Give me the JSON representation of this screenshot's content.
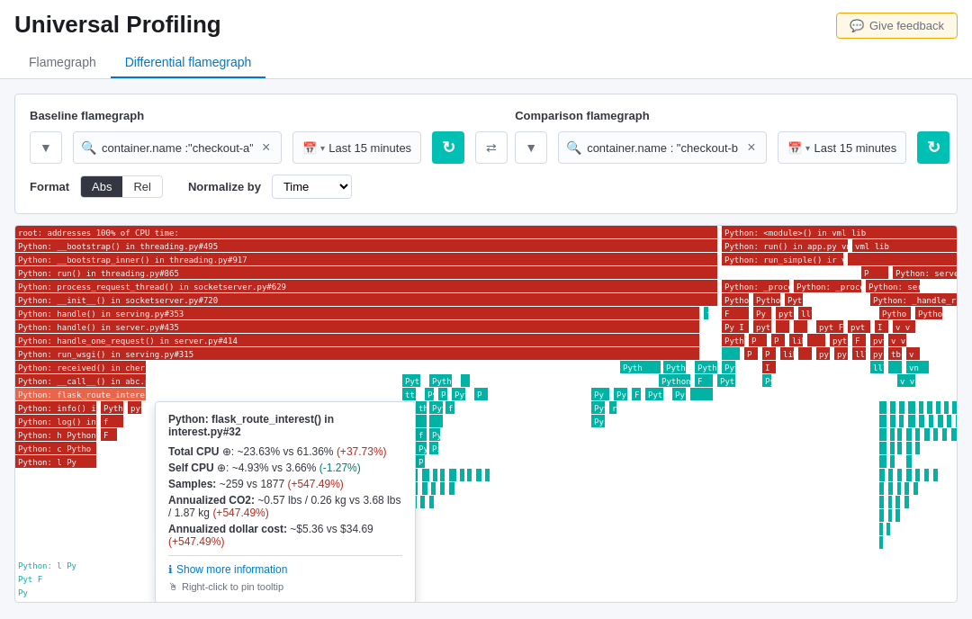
{
  "header": {
    "title": "Universal Profiling",
    "feedback_button": "Give feedback"
  },
  "tabs": [
    {
      "id": "flamegraph",
      "label": "Flamegraph",
      "active": false
    },
    {
      "id": "differential",
      "label": "Differential flamegraph",
      "active": true
    }
  ],
  "baseline": {
    "label": "Baseline flamegraph",
    "filter_placeholder": "container.name :\"checkout-a\"",
    "date_label": "Last 15 minutes"
  },
  "comparison": {
    "label": "Comparison flamegraph",
    "filter_placeholder": "container.name : \"checkout-b\"",
    "date_label": "Last 15 minutes"
  },
  "format": {
    "label": "Format",
    "options": [
      "Abs",
      "Rel"
    ],
    "active": "Abs"
  },
  "normalize": {
    "label": "Normalize by",
    "value": "Time"
  },
  "tooltip": {
    "title": "Python: flask_route_interest() in interest.py#32",
    "total_cpu_label": "Total CPU",
    "total_cpu_value": "~: ~23.63% vs 61.36% (+37.73%)",
    "self_cpu_label": "Self CPU",
    "self_cpu_value": "~: ~4.93% vs 3.66% (-1.27%)",
    "samples_label": "Samples",
    "samples_value": "~259 vs 1877 (+547.49%)",
    "co2_label": "Annualized CO2:",
    "co2_value": "~0.57 lbs / 0.26 kg vs 3.68 lbs / 1.87 kg (+547.49%)",
    "dollar_label": "Annualized dollar cost:",
    "dollar_value": "~$5.36 vs $34.69 (+547.49%)",
    "show_more": "Show more information",
    "hint": "Right-click to pin tooltip"
  }
}
